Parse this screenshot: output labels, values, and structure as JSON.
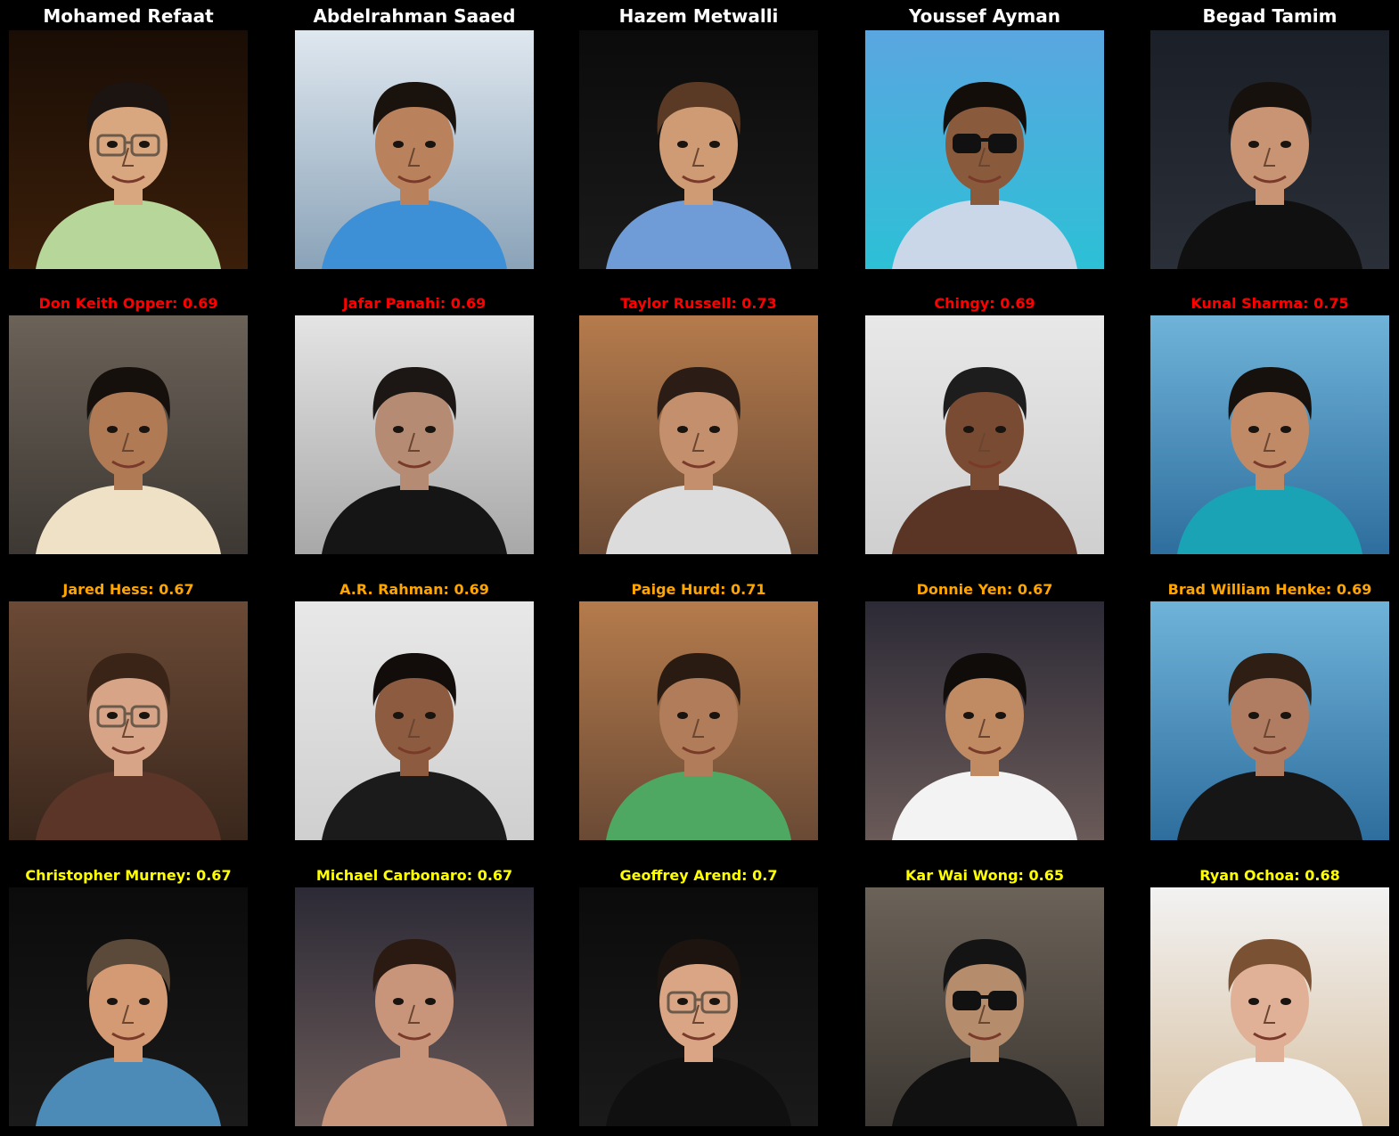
{
  "colors": {
    "background": "#000000",
    "query_label": "#ffffff",
    "rank1": "#ff0000",
    "rank2": "#ffa500",
    "rank3": "#ffff00"
  },
  "queries": [
    {
      "name": "Mohamed Refaat",
      "scene": "night-city",
      "skin": "#d9a77f",
      "hair": "#1b1410",
      "shirt": "#b7d69a",
      "glasses": "clear"
    },
    {
      "name": "Abdelrahman Saaed",
      "scene": "sea-day",
      "skin": "#b9815c",
      "hair": "#1a120d",
      "shirt": "#3d8fd6",
      "glasses": "none"
    },
    {
      "name": "Hazem Metwalli",
      "scene": "dark",
      "skin": "#cf9b74",
      "hair": "#5a3a24",
      "shirt": "#6f9cd6",
      "glasses": "none"
    },
    {
      "name": "Youssef Ayman",
      "scene": "sky-sea",
      "skin": "#8a5a3d",
      "hair": "#140e0a",
      "shirt": "#c9d7e8",
      "glasses": "dark"
    },
    {
      "name": "Begad Tamim",
      "scene": "event",
      "skin": "#c89473",
      "hair": "#17110d",
      "shirt": "#101010",
      "glasses": "none"
    }
  ],
  "matches": [
    [
      {
        "label": "Don Keith Opper: 0.69",
        "scene": "studio-grey",
        "skin": "#b07a55",
        "hair": "#15100c",
        "shirt": "#efe1c5",
        "glasses": "none"
      },
      {
        "label": "Jafar Panahi: 0.69",
        "scene": "studio-light",
        "skin": "#b58b73",
        "hair": "#1c1714",
        "shirt": "#151515",
        "glasses": "none"
      },
      {
        "label": "Taylor Russell: 0.73",
        "scene": "warm-blur",
        "skin": "#c48f6c",
        "hair": "#2b1d15",
        "shirt": "#dcdcdc",
        "glasses": "none"
      },
      {
        "label": "Chingy: 0.69",
        "scene": "press-wall",
        "skin": "#7a4b33",
        "hair": "#1d1d1d",
        "shirt": "#5a3526",
        "glasses": "none"
      },
      {
        "label": "Kunal Sharma: 0.75",
        "scene": "blue-poster",
        "skin": "#c08a67",
        "hair": "#17110d",
        "shirt": "#1aa3b5",
        "glasses": "none"
      }
    ],
    [
      {
        "label": "Jared Hess: 0.67",
        "scene": "brown-room",
        "skin": "#d7a487",
        "hair": "#3a2417",
        "shirt": "#5a3528",
        "glasses": "clear"
      },
      {
        "label": "A.R. Rahman: 0.69",
        "scene": "press-wall",
        "skin": "#8d5b3f",
        "hair": "#120d0a",
        "shirt": "#1b1b1b",
        "glasses": "none"
      },
      {
        "label": "Paige Hurd: 0.71",
        "scene": "warm-blur",
        "skin": "#b07c5a",
        "hair": "#2a1b12",
        "shirt": "#4fa861",
        "glasses": "none"
      },
      {
        "label": "Donnie Yen: 0.67",
        "scene": "dark-red",
        "skin": "#c08a63",
        "hair": "#100c0a",
        "shirt": "#f3f3f3",
        "glasses": "none"
      },
      {
        "label": "Brad William Henke: 0.69",
        "scene": "blue-poster",
        "skin": "#b07d62",
        "hair": "#2e1e14",
        "shirt": "#161616",
        "glasses": "none"
      }
    ],
    [
      {
        "label": "Christopher Murney: 0.67",
        "scene": "dark",
        "skin": "#d49a74",
        "hair": "#5b4a3a",
        "shirt": "#4c8bb8",
        "glasses": "none"
      },
      {
        "label": "Michael Carbonaro: 0.67",
        "scene": "dark-red",
        "skin": "#c9957a",
        "hair": "#2a1a12",
        "shirt": "#c9957a",
        "glasses": "none"
      },
      {
        "label": "Geoffrey Arend: 0.7",
        "scene": "dark",
        "skin": "#d9a585",
        "hair": "#1d140f",
        "shirt": "#101010",
        "glasses": "clear"
      },
      {
        "label": "Kar Wai Wong: 0.65",
        "scene": "studio-grey",
        "skin": "#b58c6c",
        "hair": "#141414",
        "shirt": "#111111",
        "glasses": "dark"
      },
      {
        "label": "Ryan Ochoa: 0.68",
        "scene": "bright",
        "skin": "#e0b196",
        "hair": "#7a5233",
        "shirt": "#f5f5f5",
        "glasses": "none"
      }
    ]
  ]
}
